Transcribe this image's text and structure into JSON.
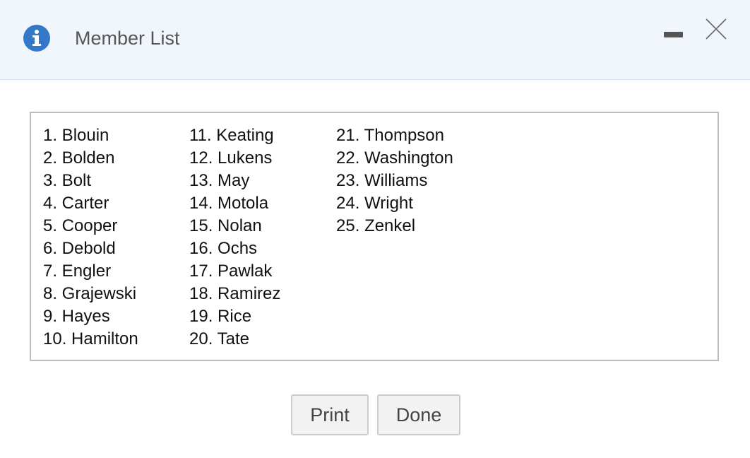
{
  "dialog": {
    "title": "Member List",
    "icons": {
      "info": "info-icon",
      "minimize": "minimize-icon",
      "close": "close-icon"
    },
    "accent_color": "#3478c9"
  },
  "members": {
    "col1": [
      "1. Blouin",
      "2. Bolden",
      "3. Bolt",
      "4. Carter",
      "5. Cooper",
      "6. Debold",
      "7. Engler",
      "8. Grajewski",
      "9. Hayes",
      "10. Hamilton"
    ],
    "col2": [
      "11. Keating",
      "12. Lukens",
      "13. May",
      "14. Motola",
      "15. Nolan",
      "16. Ochs",
      "17. Pawlak",
      "18. Ramirez",
      "19. Rice",
      "20. Tate"
    ],
    "col3": [
      "21. Thompson",
      "22. Washington",
      "23. Williams",
      "24. Wright",
      "25. Zenkel"
    ]
  },
  "buttons": {
    "print": "Print",
    "done": "Done"
  }
}
